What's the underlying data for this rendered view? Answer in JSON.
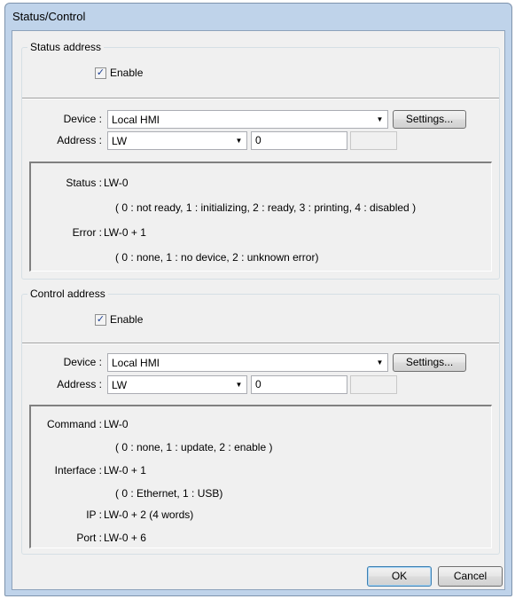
{
  "window": {
    "title": "Status/Control"
  },
  "status_group": {
    "label": "Status address",
    "enable_label": "Enable",
    "enable_checked": true,
    "device_label": "Device :",
    "device_value": "Local HMI",
    "settings_label": "Settings...",
    "address_label": "Address :",
    "address_type": "LW",
    "address_value": "0",
    "info": {
      "status_label": "Status :",
      "status_value": "LW-0",
      "status_desc": "( 0 : not ready, 1 : initializing, 2 : ready, 3 : printing, 4 : disabled )",
      "error_label": "Error :",
      "error_value": "LW-0 + 1",
      "error_desc": "( 0 : none, 1 : no device, 2 : unknown error)"
    }
  },
  "control_group": {
    "label": "Control address",
    "enable_label": "Enable",
    "enable_checked": true,
    "device_label": "Device :",
    "device_value": "Local HMI",
    "settings_label": "Settings...",
    "address_label": "Address :",
    "address_type": "LW",
    "address_value": "0",
    "info": {
      "command_label": "Command :",
      "command_value": "LW-0",
      "command_desc": "( 0 : none, 1 : update, 2 : enable )",
      "interface_label": "Interface :",
      "interface_value": "LW-0 + 1",
      "interface_desc": "( 0 : Ethernet, 1 : USB)",
      "ip_label": "IP :",
      "ip_value": "LW-0 + 2 (4 words)",
      "port_label": "Port :",
      "port_value": "LW-0 + 6"
    }
  },
  "footer": {
    "ok_label": "OK",
    "cancel_label": "Cancel"
  },
  "icons": {
    "check": "checkmark-icon",
    "dropdown": "dropdown-arrow-icon"
  }
}
